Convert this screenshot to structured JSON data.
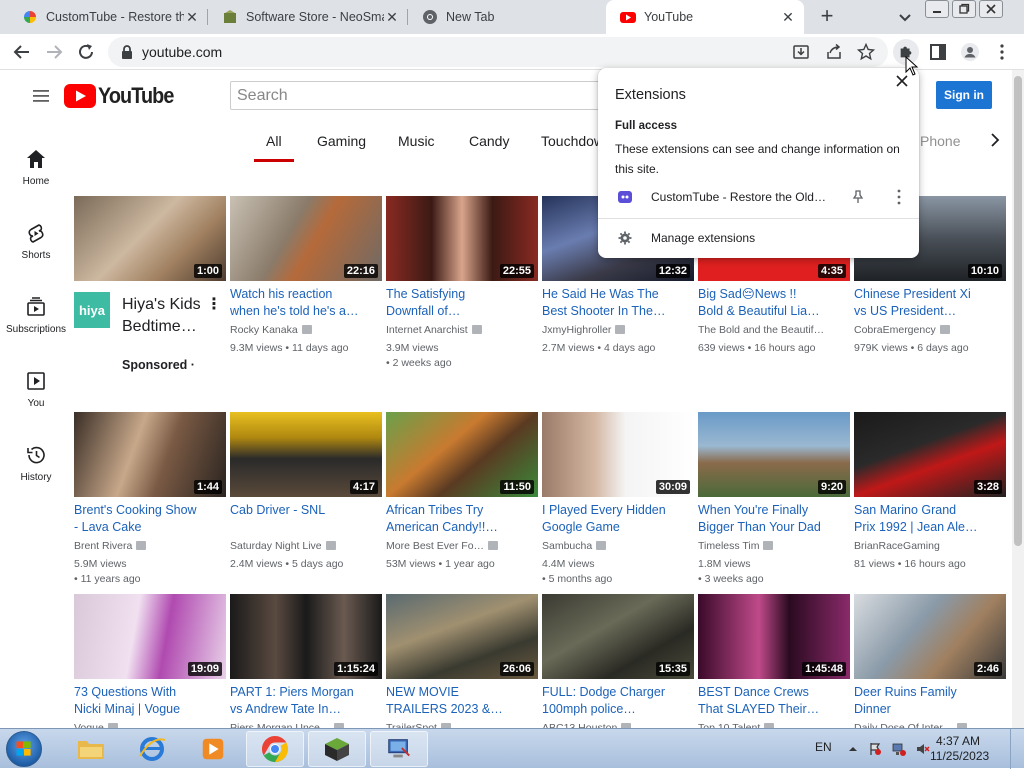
{
  "browser": {
    "tabs": [
      {
        "title": "CustomTube - Restore the Old",
        "active": false
      },
      {
        "title": "Software Store - NeoSmart",
        "active": false
      },
      {
        "title": "New Tab",
        "active": false
      },
      {
        "title": "YouTube",
        "active": true
      }
    ],
    "url": "youtube.com"
  },
  "header": {
    "logo_text": "YouTube",
    "search_placeholder": "Search",
    "signin_label": "Sign in"
  },
  "leftnav": [
    {
      "label": "Home",
      "icon": "home-icon"
    },
    {
      "label": "Shorts",
      "icon": "shorts-icon"
    },
    {
      "label": "Subscriptions",
      "icon": "subscriptions-icon"
    },
    {
      "label": "You",
      "icon": "you-icon"
    },
    {
      "label": "History",
      "icon": "history-icon"
    }
  ],
  "chips": [
    "All",
    "Gaming",
    "Music",
    "Candy",
    "Touchdow",
    "Phone"
  ],
  "sponsored": {
    "logo_text": "hiya",
    "title": "Hiya's Kids\nBedtime…",
    "label": "Sponsored ·"
  },
  "videos": [
    {
      "duration": "1:00"
    },
    {
      "duration": "22:16",
      "title": "Watch his reaction\nwhen he's told he's a…",
      "channel": "Rocky Kanaka",
      "meta": "9.3M views • 11 days ago"
    },
    {
      "duration": "22:55",
      "title": "The Satisfying\nDownfall of…",
      "channel": "Internet Anarchist",
      "meta": "3.9M views",
      "meta2": "• 2 weeks ago"
    },
    {
      "duration": "12:32",
      "title": "He Said He Was The\nBest Shooter In The…",
      "channel": "JxmyHighroller",
      "meta": "2.7M views • 4 days ago"
    },
    {
      "duration": "4:35",
      "title": "Big Sad😔News !!\nBold & Beautiful Lia…",
      "channel": "The Bold and the Beautif…",
      "meta": "639 views • 16 hours ago"
    },
    {
      "duration": "10:10",
      "title": "Chinese President Xi\nvs US President…",
      "channel": "CobraEmergency",
      "meta": "979K views • 6 days ago"
    },
    {
      "duration": "1:44",
      "title": "Brent's Cooking Show\n- Lava Cake",
      "channel": "Brent Rivera",
      "meta": "5.9M views",
      "meta2": "• 11 years ago"
    },
    {
      "duration": "4:17",
      "title": "Cab Driver - SNL",
      "channel": "Saturday Night Live",
      "meta": "2.4M views • 5 days ago"
    },
    {
      "duration": "11:50",
      "title": "African Tribes Try\nAmerican Candy!!…",
      "channel": "More Best Ever Fo…",
      "meta": "53M views • 1 year ago"
    },
    {
      "duration": "30:09",
      "title": "I Played Every Hidden\nGoogle Game",
      "channel": "Sambucha",
      "meta": "4.4M views",
      "meta2": "• 5 months ago"
    },
    {
      "duration": "9:20",
      "title": "When You're Finally\nBigger Than Your Dad",
      "channel": "Timeless Tim",
      "meta": "1.8M views",
      "meta2": "• 3 weeks ago"
    },
    {
      "duration": "3:28",
      "title": "San Marino Grand\nPrix 1992 | Jean Ale…",
      "channel": "BrianRaceGaming",
      "meta": "81 views • 16 hours ago"
    },
    {
      "duration": "19:09",
      "title": "73 Questions With\nNicki Minaj | Vogue",
      "channel": "Vogue"
    },
    {
      "duration": "1:15:24",
      "title": "PART 1: Piers Morgan\nvs Andrew Tate In…",
      "channel": "Piers Morgan Unce…"
    },
    {
      "duration": "26:06",
      "title": "NEW MOVIE\nTRAILERS 2023 &…",
      "channel": "TrailerSpot"
    },
    {
      "duration": "15:35",
      "title": "FULL: Dodge Charger\n100mph police…",
      "channel": "ABC13 Houston"
    },
    {
      "duration": "1:45:48",
      "title": "BEST Dance Crews\nThat SLAYED Their…",
      "channel": "Top 10 Talent"
    },
    {
      "duration": "2:46",
      "title": "Deer Ruins Family\nDinner",
      "channel": "Daily Dose Of Inter…"
    }
  ],
  "extensions_popup": {
    "title": "Extensions",
    "section": "Full access",
    "description": "These extensions can see and change information on this site.",
    "extension_name": "CustomTube - Restore the Old…",
    "manage_label": "Manage extensions"
  },
  "taskbar": {
    "lang": "EN",
    "time": "4:37 AM",
    "date": "11/25/2023"
  },
  "colors": {
    "yt_red": "#ff0000",
    "link_blue": "#1c62b9",
    "signin_blue": "#1c74d3",
    "chip_underline": "#cc0000"
  }
}
